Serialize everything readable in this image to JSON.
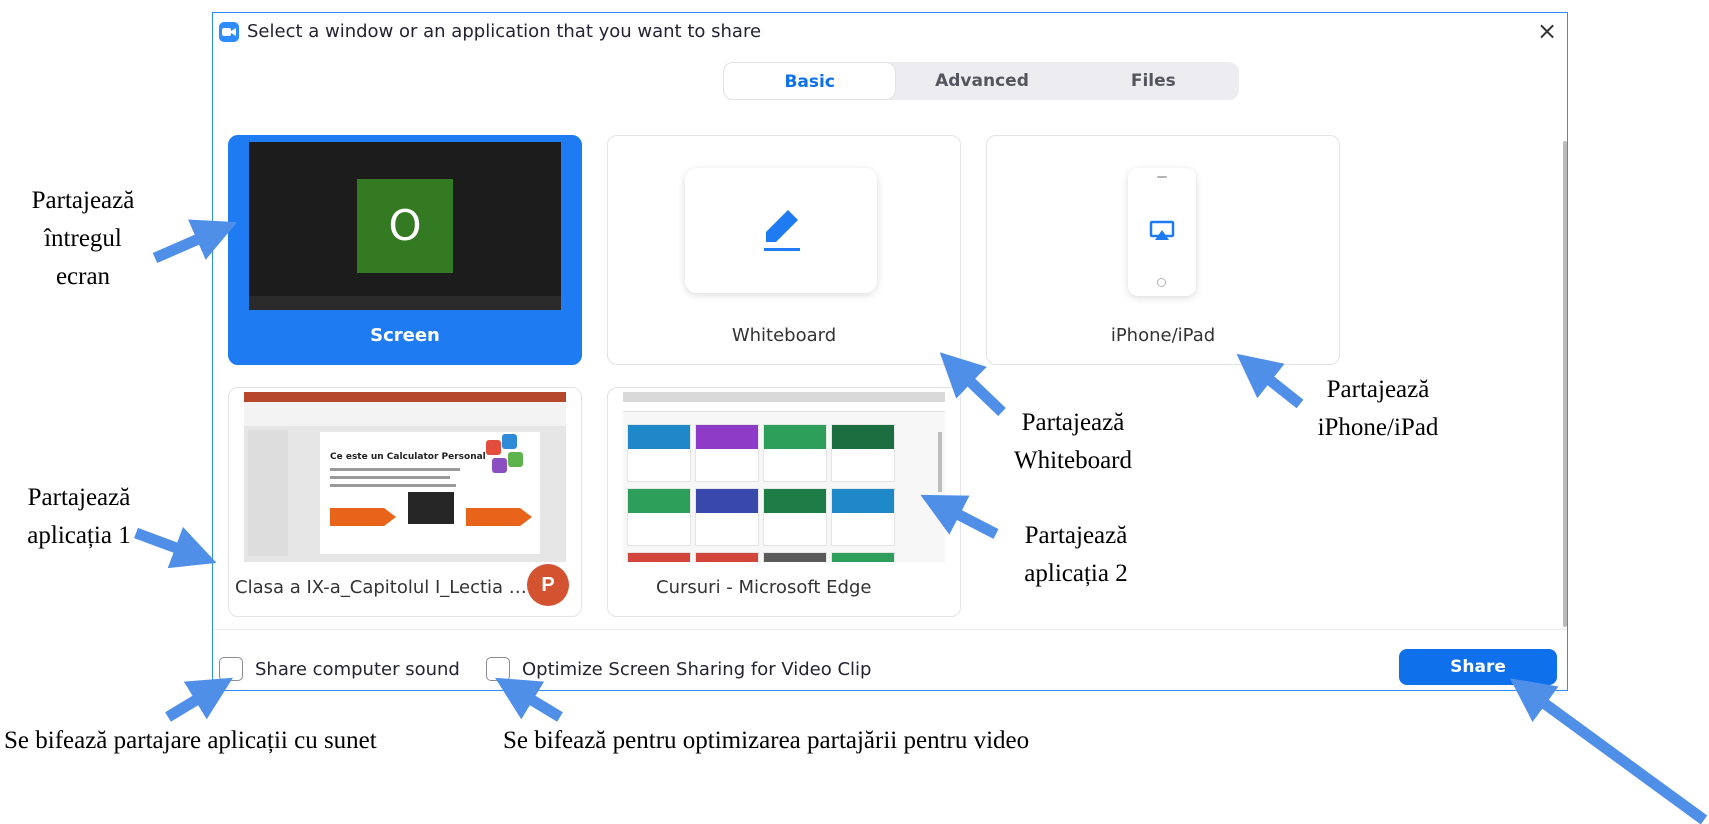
{
  "dialog": {
    "title": "Select a window or an application that you want to share",
    "close_label": "×"
  },
  "tabs": [
    {
      "label": "Basic",
      "active": true
    },
    {
      "label": "Advanced",
      "active": false
    },
    {
      "label": "Files",
      "active": false
    }
  ],
  "tiles": {
    "screen": {
      "label": "Screen",
      "selected": true,
      "avatar_letter": "O"
    },
    "whiteboard": {
      "label": "Whiteboard",
      "icon": "pen-icon"
    },
    "iphone": {
      "label": "iPhone/iPad",
      "icon": "airplay-icon"
    },
    "app1": {
      "label": "Clasa a IX-a_Capitolul I_Lectia 1 -...",
      "badge": "P",
      "slide_title": "Ce este un Calculator Personal"
    },
    "app2": {
      "label": "Cursuri - Microsoft Edge"
    }
  },
  "options": {
    "computer_sound": {
      "label": "Share computer sound",
      "checked": false
    },
    "optimize_video": {
      "label": "Optimize Screen Sharing for Video Clip",
      "checked": false
    }
  },
  "share_button": {
    "label": "Share"
  },
  "annotations": {
    "entire_screen": [
      "Partajează",
      "întregul",
      "ecran"
    ],
    "whiteboard": [
      "Partajează",
      "Whiteboard"
    ],
    "iphone": [
      "Partajează",
      "iPhone/iPad"
    ],
    "app1": [
      "Partajează",
      "aplicația 1"
    ],
    "app2": [
      "Partajează",
      "aplicația 2"
    ],
    "sound": "Se bifează partajare aplicații cu sunet",
    "video": "Se bifează pentru optimizarea partajării pentru video"
  },
  "colors": {
    "accent": "#0E71EB",
    "selected_tile": "#1F7BF2",
    "arrow": "#4F8FE8",
    "avatar_bg": "#347A22"
  }
}
